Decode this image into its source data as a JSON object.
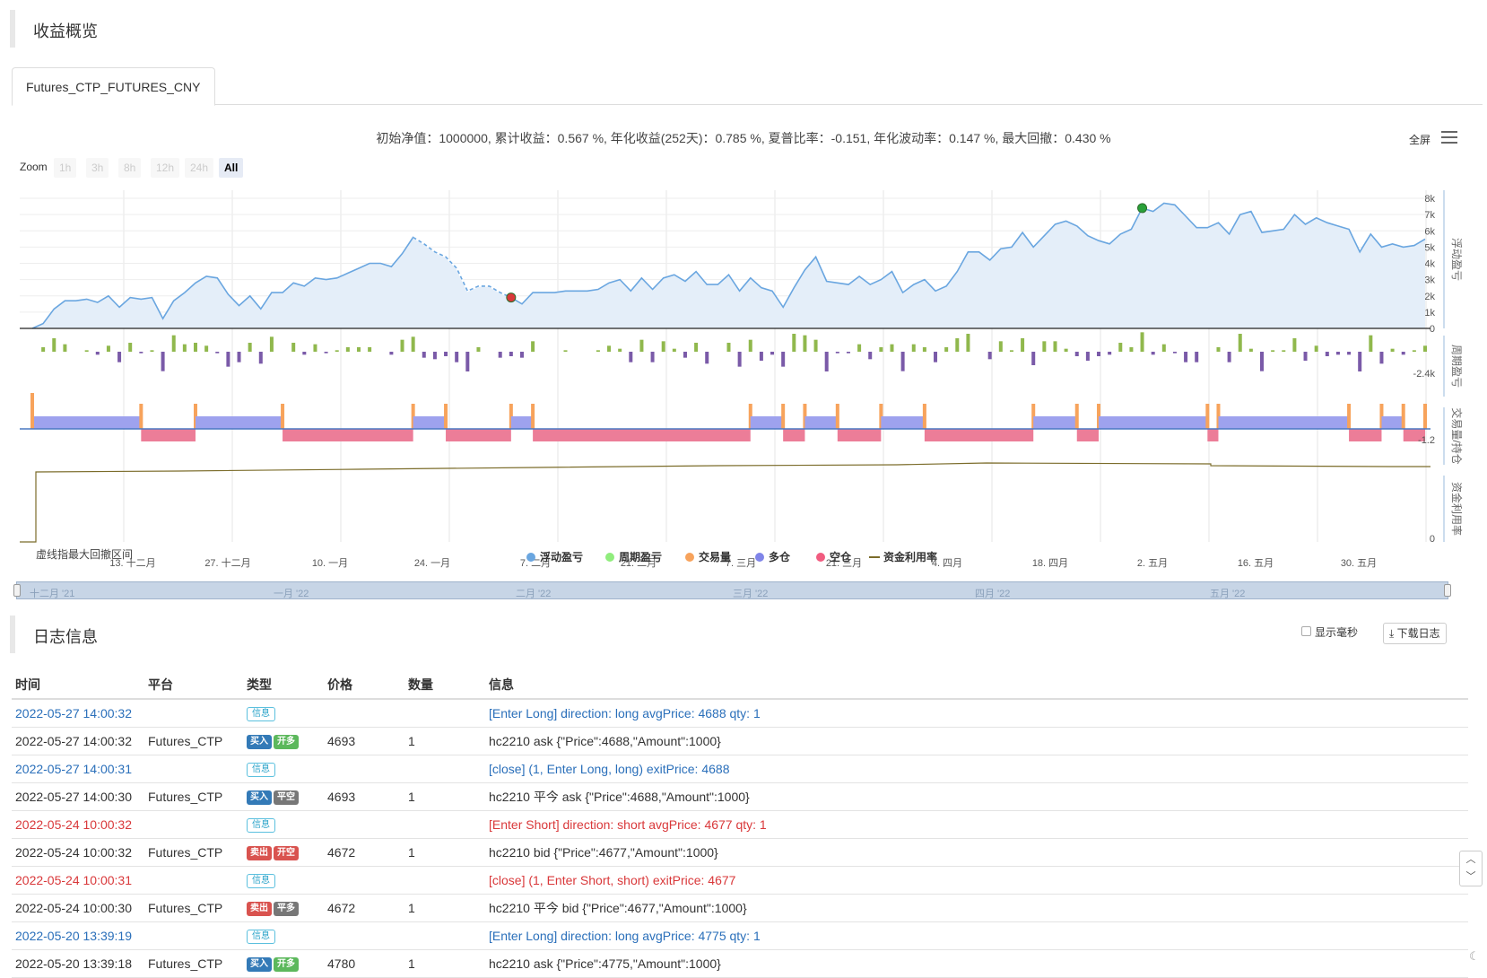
{
  "overview": {
    "title": "收益概览"
  },
  "tab": {
    "label": "Futures_CTP_FUTURES_CNY"
  },
  "summary": "初始净值：1000000, 累计收益：0.567 %, 年化收益(252天)：0.785 %, 夏普比率：-0.151, 年化波动率：0.147 %, 最大回撤：0.430 %",
  "toolbar": {
    "fullscreen": "全屏",
    "menu_icon": "menu-icon"
  },
  "zoom": {
    "label": "Zoom",
    "buttons": [
      "1h",
      "3h",
      "8h",
      "12h",
      "24h",
      "All"
    ],
    "active": "All"
  },
  "chart_data": {
    "type": "line",
    "x_ticks": [
      "13. 十二月",
      "27. 十二月",
      "10. 一月",
      "24. 一月",
      "7. 二月",
      "21. 二月",
      "7. 三月",
      "21. 三月",
      "4. 四月",
      "18. 四月",
      "2. 五月",
      "16. 五月",
      "30. 五月"
    ],
    "panels": [
      {
        "name": "浮动盈亏",
        "y_ticks": [
          "0",
          "1k",
          "2k",
          "3k",
          "4k",
          "5k",
          "6k",
          "7k",
          "8k"
        ],
        "ylim": [
          0,
          8500
        ],
        "values": [
          0,
          300,
          1200,
          1700,
          1700,
          1800,
          1600,
          2000,
          1300,
          1900,
          1800,
          1900,
          600,
          1700,
          2200,
          2800,
          3200,
          3100,
          2100,
          1400,
          2000,
          1200,
          2200,
          2200,
          2800,
          2600,
          3100,
          3000,
          3100,
          3400,
          3700,
          4000,
          4000,
          3800,
          4600,
          5600,
          5200,
          4700,
          4400,
          3700,
          2300,
          2600,
          2600,
          2200,
          1900,
          1500,
          2200,
          2200,
          2200,
          2300,
          2300,
          2300,
          2400,
          2800,
          3000,
          2300,
          3100,
          2400,
          3100,
          3300,
          2900,
          3500,
          2700,
          2700,
          3300,
          2300,
          3100,
          2500,
          2300,
          1300,
          2500,
          3600,
          4400,
          2900,
          2800,
          2700,
          3200,
          2700,
          3000,
          3500,
          2200,
          2700,
          3000,
          2300,
          2600,
          3500,
          4700,
          4700,
          4200,
          4900,
          5000,
          5900,
          5000,
          5700,
          6400,
          6600,
          6300,
          5700,
          5400,
          5200,
          5800,
          6100,
          7400,
          7200,
          7700,
          7600,
          6900,
          6200,
          6200,
          6500,
          5800,
          7000,
          7200,
          5900,
          6000,
          6100,
          7000,
          6400,
          6800,
          6500,
          6300,
          6100,
          4700,
          5800,
          5000,
          5200,
          5000,
          5100,
          5500
        ],
        "markers": [
          {
            "index": 44,
            "color": "#d9383a"
          },
          {
            "index": 102,
            "color": "#2aa13a"
          }
        ]
      },
      {
        "name": "周期盈亏",
        "y_ticks": [
          "-2.4k"
        ]
      },
      {
        "name": "交易量/持仓",
        "y_ticks": [
          "-1.2"
        ]
      },
      {
        "name": "资金利用率",
        "y_ticks": [
          "0"
        ]
      }
    ],
    "legend": [
      {
        "name": "浮动盈亏",
        "color": "#6aa6e0"
      },
      {
        "name": "周期盈亏",
        "color": "#90ed7d"
      },
      {
        "name": "交易量",
        "color": "#f7a35c"
      },
      {
        "name": "多仓",
        "color": "#8085e9"
      },
      {
        "name": "空仓",
        "color": "#f15c80"
      },
      {
        "name": "资金利用率",
        "color": "#7b6c2a"
      }
    ],
    "note": "虚线指最大回撤区间"
  },
  "navigator": {
    "labels": [
      "十二月 '21",
      "一月 '22",
      "二月 '22",
      "三月 '22",
      "四月 '22",
      "五月 '22"
    ]
  },
  "log": {
    "title": "日志信息",
    "show_ms": "显示毫秒",
    "download": "下载日志",
    "columns": [
      "时间",
      "平台",
      "类型",
      "价格",
      "数量",
      "信息"
    ],
    "rows": [
      {
        "time": "2022-05-27 14:00:32",
        "platform": "",
        "badges": [
          "信息"
        ],
        "price": "",
        "qty": "",
        "info": "[Enter Long] direction: long avgPrice: 4688 qty: 1",
        "color": "blue"
      },
      {
        "time": "2022-05-27 14:00:32",
        "platform": "Futures_CTP",
        "badges": [
          "买入",
          "开多"
        ],
        "price": "4693",
        "qty": "1",
        "info": "hc2210 ask {\"Price\":4688,\"Amount\":1000}",
        "color": ""
      },
      {
        "time": "2022-05-27 14:00:31",
        "platform": "",
        "badges": [
          "信息"
        ],
        "price": "",
        "qty": "",
        "info": "[close] (1, Enter Long, long) exitPrice: 4688",
        "color": "blue"
      },
      {
        "time": "2022-05-27 14:00:30",
        "platform": "Futures_CTP",
        "badges": [
          "买入",
          "平空"
        ],
        "price": "4693",
        "qty": "1",
        "info": "hc2210 平今 ask {\"Price\":4688,\"Amount\":1000}",
        "color": ""
      },
      {
        "time": "2022-05-24 10:00:32",
        "platform": "",
        "badges": [
          "信息"
        ],
        "price": "",
        "qty": "",
        "info": "[Enter Short] direction: short avgPrice: 4677 qty: 1",
        "color": "red"
      },
      {
        "time": "2022-05-24 10:00:32",
        "platform": "Futures_CTP",
        "badges": [
          "卖出",
          "开空"
        ],
        "price": "4672",
        "qty": "1",
        "info": "hc2210 bid {\"Price\":4677,\"Amount\":1000}",
        "color": ""
      },
      {
        "time": "2022-05-24 10:00:31",
        "platform": "",
        "badges": [
          "信息"
        ],
        "price": "",
        "qty": "",
        "info": "[close] (1, Enter Short, short) exitPrice: 4677",
        "color": "red"
      },
      {
        "time": "2022-05-24 10:00:30",
        "platform": "Futures_CTP",
        "badges": [
          "卖出",
          "平多"
        ],
        "price": "4672",
        "qty": "1",
        "info": "hc2210 平今 bid {\"Price\":4677,\"Amount\":1000}",
        "color": ""
      },
      {
        "time": "2022-05-20 13:39:19",
        "platform": "",
        "badges": [
          "信息"
        ],
        "price": "",
        "qty": "",
        "info": "[Enter Long] direction: long avgPrice: 4775 qty: 1",
        "color": "blue"
      },
      {
        "time": "2022-05-20 13:39:18",
        "platform": "Futures_CTP",
        "badges": [
          "买入",
          "开多"
        ],
        "price": "4780",
        "qty": "1",
        "info": "hc2210 ask {\"Price\":4775,\"Amount\":1000}",
        "color": ""
      }
    ]
  }
}
